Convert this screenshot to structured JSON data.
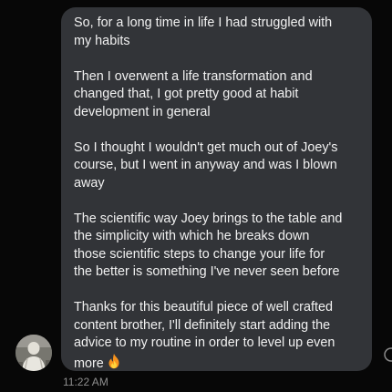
{
  "message": {
    "paragraphs": [
      "So, for a long time in life I had struggled with\nmy habits",
      "Then I overwent a life transformation and\nchanged that, I got pretty good at habit\ndevelopment in general",
      "So I thought I wouldn't get much out of Joey's\ncourse, but I went in anyway and was I blown\naway",
      "The scientific way Joey brings to the table and\nthe simplicity with which he breaks down\nthose scientific steps to change your life for\nthe better is something I've never seen before"
    ],
    "last_paragraph": "Thanks for this beautiful piece of well crafted\ncontent brother, I'll definitely start adding the\nadvice to my routine in order to level up even\nmore",
    "emoji": "fire-emoji",
    "timestamp": "11:22 AM"
  },
  "sender": {
    "avatar": "avatar-photo"
  },
  "colors": {
    "background": "#070707",
    "bubble": "#323438",
    "text": "#f1f1f1",
    "timestamp": "#8e8e8e"
  }
}
